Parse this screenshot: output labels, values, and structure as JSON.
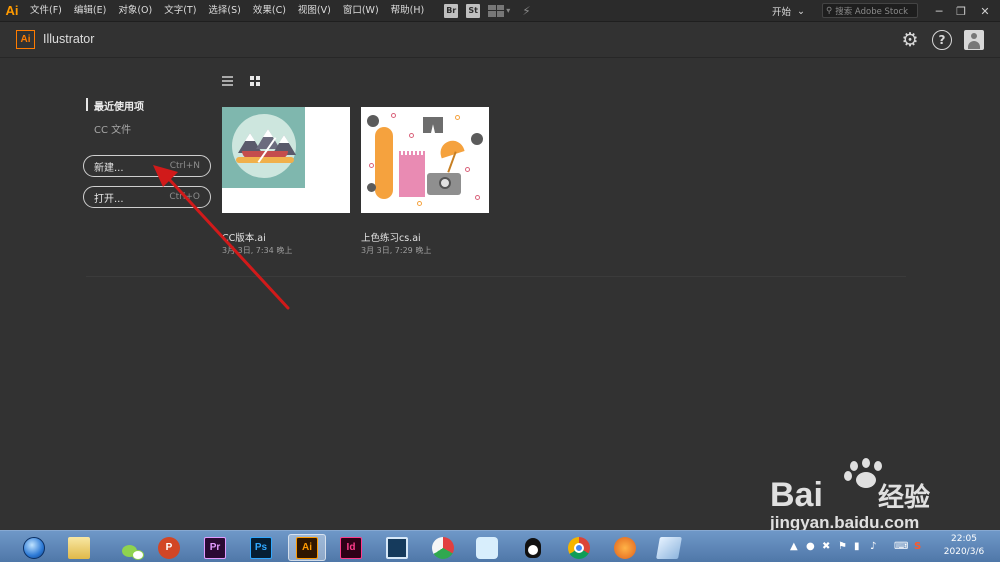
{
  "menubar": {
    "logo": "Ai",
    "items": [
      "文件(F)",
      "编辑(E)",
      "对象(O)",
      "文字(T)",
      "选择(S)",
      "效果(C)",
      "视图(V)",
      "窗口(W)",
      "帮助(H)"
    ],
    "bridge": "Br",
    "stock": "St",
    "workspace": "开始",
    "search_placeholder": "搜索 Adobe Stock",
    "win_min": "─",
    "win_restore": "❐",
    "win_close": "✕"
  },
  "header": {
    "logo": "Ai",
    "app_name": "Illustrator",
    "help": "?"
  },
  "sidebar": {
    "recent": "最近使用项",
    "cc_files": "CC 文件",
    "new_label": "新建...",
    "new_shortcut": "Ctrl+N",
    "open_label": "打开...",
    "open_shortcut": "Ctrl+O"
  },
  "files": [
    {
      "name": "CC版本.ai",
      "date": "3月 3日, 7:34 晚上"
    },
    {
      "name": "上色练习cs.ai",
      "date": "3月 3日, 7:29 晚上"
    }
  ],
  "taskbar": {
    "apps": [
      "ie",
      "explorer",
      "wechat",
      "powerpoint",
      "premiere",
      "photoshop",
      "illustrator",
      "indesign",
      "video",
      "pie-app",
      "bird-app",
      "qq",
      "chrome",
      "firefox",
      "notes"
    ],
    "labels": {
      "ppt": "P",
      "pr": "Pr",
      "ps": "Ps",
      "ai": "Ai",
      "id": "Id"
    }
  },
  "tray": {
    "time": "22:05",
    "date": "2020/3/6"
  },
  "watermark": {
    "brand": "Bai",
    "brand2": "经验",
    "url": "jingyan.baidu.com"
  },
  "colors": {
    "accent": "#ff7c00",
    "arrow": "#d11a1a",
    "background": "#323232"
  }
}
